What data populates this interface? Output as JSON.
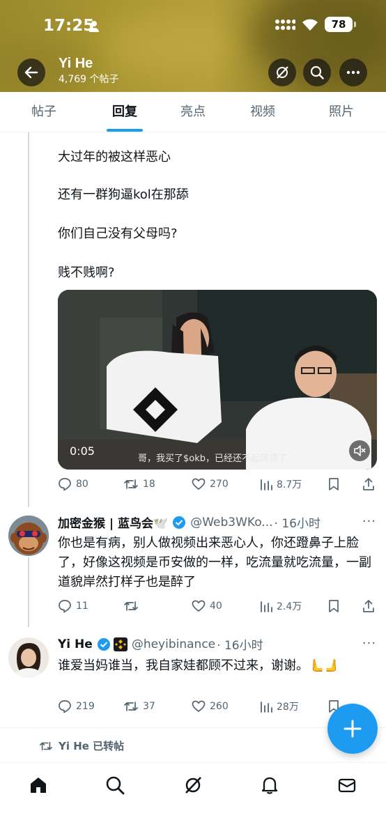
{
  "status_bar": {
    "time": "17:25",
    "battery": "78"
  },
  "header": {
    "name": "Yi He",
    "post_count": "4,769 个帖子"
  },
  "tabs": [
    {
      "label": "帖子",
      "active": false
    },
    {
      "label": "回复",
      "active": true
    },
    {
      "label": "亮点",
      "active": false
    },
    {
      "label": "视频",
      "active": false
    },
    {
      "label": "照片",
      "active": false
    }
  ],
  "original_post": {
    "lines": [
      "大过年的被这样恶心",
      "还有一群狗逼kol在那舔",
      "你们自己没有父母吗?",
      "贱不贱啊?"
    ],
    "video": {
      "time": "0:05",
      "subtitle": "哥，我买了$okb，已经还不起房贷了"
    },
    "stats": {
      "replies": "80",
      "retweets": "18",
      "likes": "270",
      "views": "8.7万"
    }
  },
  "reply_1": {
    "name": "加密金猴 | 蓝鸟会🕊️",
    "handle": "@Web3WKo...",
    "time": "· 16小时",
    "text": "你也是有病，别人做视频出来恶心人，你还蹬鼻子上脸了，好像这视频是币安做的一样，吃流量就吃流量，一副道貌岸然打样子也是醉了",
    "stats": {
      "replies": "11",
      "retweets": "",
      "likes": "40",
      "views": "2.4万"
    }
  },
  "reply_2": {
    "name": "Yi He",
    "handle": "@heyibinance",
    "time": "· 16小时",
    "text": "谁爱当妈谁当，我自家娃都顾不过来，谢谢。🫷🫸",
    "stats": {
      "replies": "219",
      "retweets": "37",
      "likes": "260",
      "views": "28万"
    }
  },
  "retweet_notice": "Yi He 已转帖",
  "colors": {
    "accent": "#1d9bf0",
    "muted": "#536471",
    "verified": "#1d9bf0",
    "binance": "#f0b90b"
  }
}
